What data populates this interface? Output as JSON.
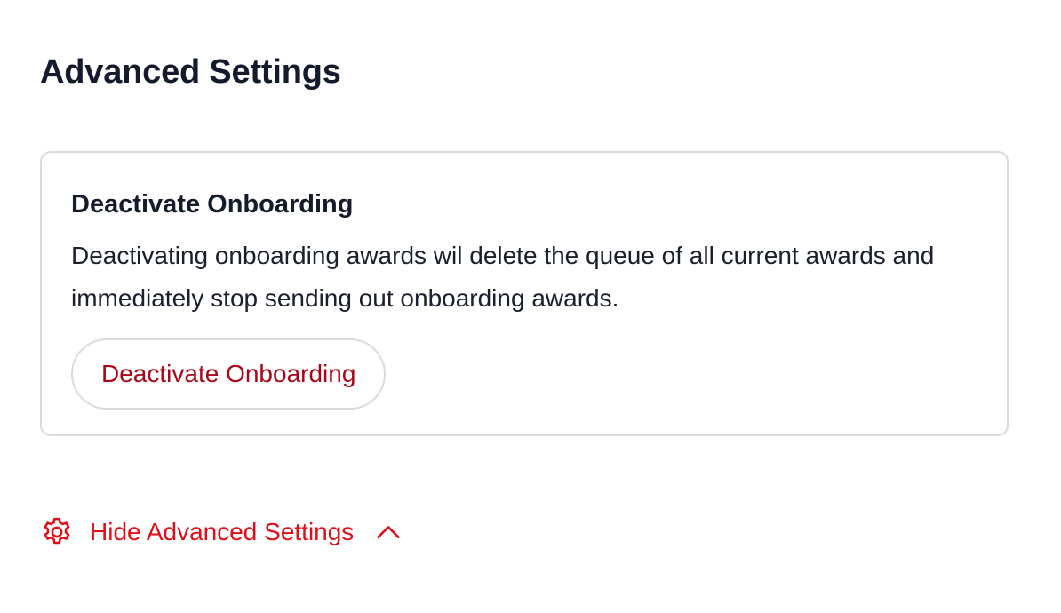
{
  "page": {
    "title": "Advanced Settings"
  },
  "deactivate_card": {
    "title": "Deactivate Onboarding",
    "description": "Deactivating onboarding awards wil delete the queue of all current awards and immediately stop sending out onboarding awards.",
    "button_label": "Deactivate Onboarding"
  },
  "toggle": {
    "label": "Hide Advanced Settings",
    "icon": "gear-icon",
    "chevron_icon": "chevron-up-icon"
  },
  "colors": {
    "text_primary": "#141b2d",
    "danger_text": "#a8071a",
    "accent_red": "#e10d17",
    "border": "#d9dadd"
  }
}
